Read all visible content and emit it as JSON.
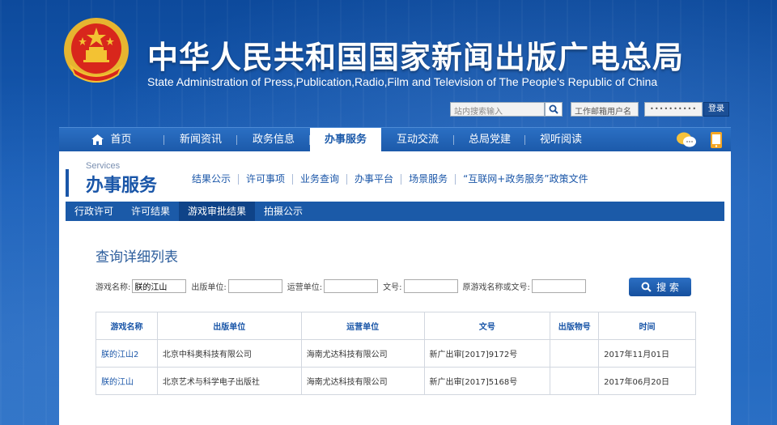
{
  "site": {
    "title": "中华人民共和国国家新闻出版广电总局",
    "subtitle": "State Administration of Press,Publication,Radio,Film and Television of The People's Republic of China",
    "search_placeholder": "站内搜索输入",
    "email_placeholder": "工作邮箱用户名",
    "password_mask": "••••••••••",
    "login_label": "登录"
  },
  "nav": {
    "items": [
      {
        "label": "首页",
        "icon": "home-icon"
      },
      {
        "label": "新闻资讯"
      },
      {
        "label": "政务信息"
      },
      {
        "label": "办事服务",
        "active": true
      },
      {
        "label": "互动交流"
      },
      {
        "label": "总局党建"
      },
      {
        "label": "视听阅读"
      }
    ],
    "right_icons": [
      "chat-bubbles-icon",
      "mobile-icon"
    ]
  },
  "service": {
    "en": "Services",
    "cn": "办事服务",
    "sub_links": [
      "结果公示",
      "许可事项",
      "业务查询",
      "办事平台",
      "场景服务",
      "“互联网+政务服务”政策文件"
    ],
    "sub_nav": [
      "行政许可",
      "许可结果",
      "游戏审批结果",
      "拍摄公示"
    ]
  },
  "page_title": "查询详细列表",
  "form": {
    "game_name_label": "游戏名称:",
    "game_name_value": "朕的江山",
    "publisher_label": "出版单位:",
    "publisher_value": "",
    "operator_label": "运营单位:",
    "operator_value": "",
    "doc_no_label": "文号:",
    "doc_no_value": "",
    "orig_label": "原游戏名称或文号:",
    "orig_value": "",
    "search_label": "搜 索"
  },
  "table": {
    "headers": [
      "游戏名称",
      "出版单位",
      "运营单位",
      "文号",
      "出版物号",
      "时间"
    ],
    "rows": [
      [
        "朕的江山2",
        "北京中科奥科技有限公司",
        "海南尤达科技有限公司",
        "新广出审[2017]9172号",
        "",
        "2017年11月01日"
      ],
      [
        "朕的江山",
        "北京艺术与科学电子出版社",
        "海南尤达科技有限公司",
        "新广出审[2017]5168号",
        "",
        "2017年06月20日"
      ]
    ]
  },
  "colors": {
    "brand_blue": "#1a56a8",
    "header_bg": "#0d4a9c",
    "emblem_red": "#d8261c",
    "emblem_gold": "#f3c233"
  }
}
